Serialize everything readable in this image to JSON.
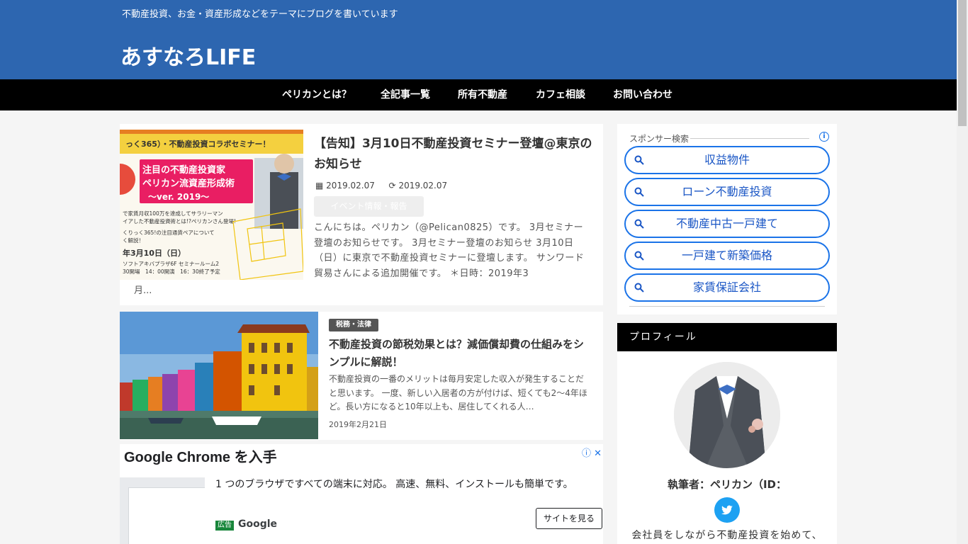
{
  "header": {
    "tagline": "不動産投資、お金・資産形成などをテーマにブログを書いています",
    "site_title": "あすなろLIFE"
  },
  "nav": {
    "items": [
      {
        "label": "ペリカンとは？"
      },
      {
        "label": "全記事一覧"
      },
      {
        "label": "所有不動産"
      },
      {
        "label": "カフェ相談"
      },
      {
        "label": "お問い合わせ"
      }
    ]
  },
  "posts": [
    {
      "title": "【告知】3月10日不動産投資セミナー登壇@東京のお知らせ",
      "published": "2019.02.07",
      "updated": "2019.02.07",
      "category": "イベント情報・報告",
      "excerpt": "こんにちは。ペリカン（@Pelican0825）です。 3月セミナー登壇のお知らせです。 3月セミナー登壇のお知らせ 3月10日（日）に東京で不動産投資セミナーに登壇します。 サンワード貿易さんによる追加開催です。 ＊日時：2019年3",
      "excerpt_tail": "月...",
      "thumb": {
        "banner": "っく365）・不動産投資コラボセミナー！",
        "head1": "注目の不動産投資家",
        "head2": "ペリカン流資産形成術",
        "head3": "〜ver. 2019〜",
        "line1": "で家賃月収100万を達成してサラリーマン",
        "line2": "イアした不動産投資術とは!?ペリカンさん登場!",
        "line3": "くりっく365!の注目通貨ペアについて",
        "line4": "く解説！",
        "date": "年3月10日（日）",
        "venue": "ソフトアキバプラザ6F セミナールーム2",
        "time": "30開場　14：00開演　16：30終了予定"
      }
    },
    {
      "category": "税務・法律",
      "title": "不動産投資の節税効果とは？減価償却費の仕組みをシンプルに解説！",
      "excerpt": "不動産投資の一番のメリットは毎月安定した収入が発生することだと思います。 一度、新しい入居者の方が付けば、短くても2〜4年ほど。長い方になると10年以上も、居住してくれる人…",
      "date": "2019年2月21日"
    }
  ],
  "ad": {
    "title": "Google Chrome を入手",
    "text": "1 つのブラウザですべての端末に対応。 高速、無料、インストールも簡単です。",
    "badge": "広告",
    "brand": "Google",
    "button": "サイトを見る",
    "icons": "ⓘ ✕"
  },
  "sidebar": {
    "sponsor_label": "スポンサー検索",
    "info_icon": "i",
    "searches": [
      {
        "label": "収益物件"
      },
      {
        "label": "ローン不動産投資"
      },
      {
        "label": "不動産中古一戸建て"
      },
      {
        "label": "一戸建て新築価格"
      },
      {
        "label": "家賃保証会社"
      }
    ],
    "profile": {
      "heading": "プロフィール",
      "name": "執筆者：ペリカン（ID：",
      "bio": "会社員をしながら不動産投資を始めて、"
    }
  },
  "colors": {
    "header_bg": "#2d66b0",
    "nav_bg": "#000000",
    "accent": "#1a73e8",
    "twitter": "#1da1f2"
  }
}
